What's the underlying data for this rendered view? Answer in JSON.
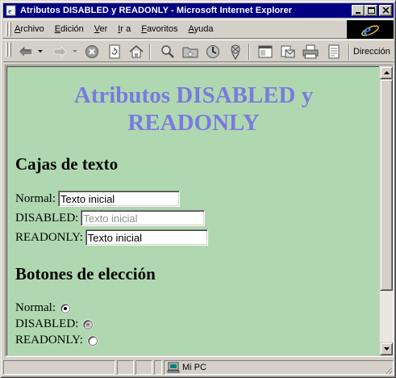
{
  "window": {
    "title": "Atributos DISABLED y READONLY - Microsoft Internet Explorer"
  },
  "menu": {
    "items": [
      {
        "accel": "A",
        "rest": "rchivo"
      },
      {
        "accel": "E",
        "rest": "dición"
      },
      {
        "accel": "V",
        "rest": "er"
      },
      {
        "accel": "I",
        "rest": "r a"
      },
      {
        "accel": "F",
        "rest": "avoritos"
      },
      {
        "accel": "A",
        "rest": "yuda"
      }
    ]
  },
  "toolbar": {
    "buttons": [
      "back-icon",
      "forward-icon",
      "stop-icon",
      "refresh-icon",
      "home-icon",
      "search-icon",
      "favorites-icon",
      "history-icon",
      "channels-icon",
      "fullscreen-icon",
      "mail-icon",
      "print-icon",
      "edit-icon"
    ],
    "address_label": "Dirección"
  },
  "page": {
    "title": "Atributos DISABLED y READONLY",
    "title_color": "#7a7ae0",
    "background": "#b0d8b0",
    "textboxes_heading": "Cajas de texto",
    "textboxes": [
      {
        "label": "Normal:",
        "value": "Texto inicial",
        "state": "normal"
      },
      {
        "label": "DISABLED:",
        "value": "Texto inicial",
        "state": "disabled"
      },
      {
        "label": "READONLY:",
        "value": "Texto inicial",
        "state": "readonly"
      }
    ],
    "radios_heading": "Botones de elección",
    "radios": [
      {
        "label": "Normal:",
        "checked": true,
        "state": "normal"
      },
      {
        "label": "DISABLED:",
        "checked": true,
        "state": "disabled"
      },
      {
        "label": "READONLY:",
        "checked": false,
        "state": "readonly"
      }
    ]
  },
  "status": {
    "zone": "Mi PC"
  }
}
